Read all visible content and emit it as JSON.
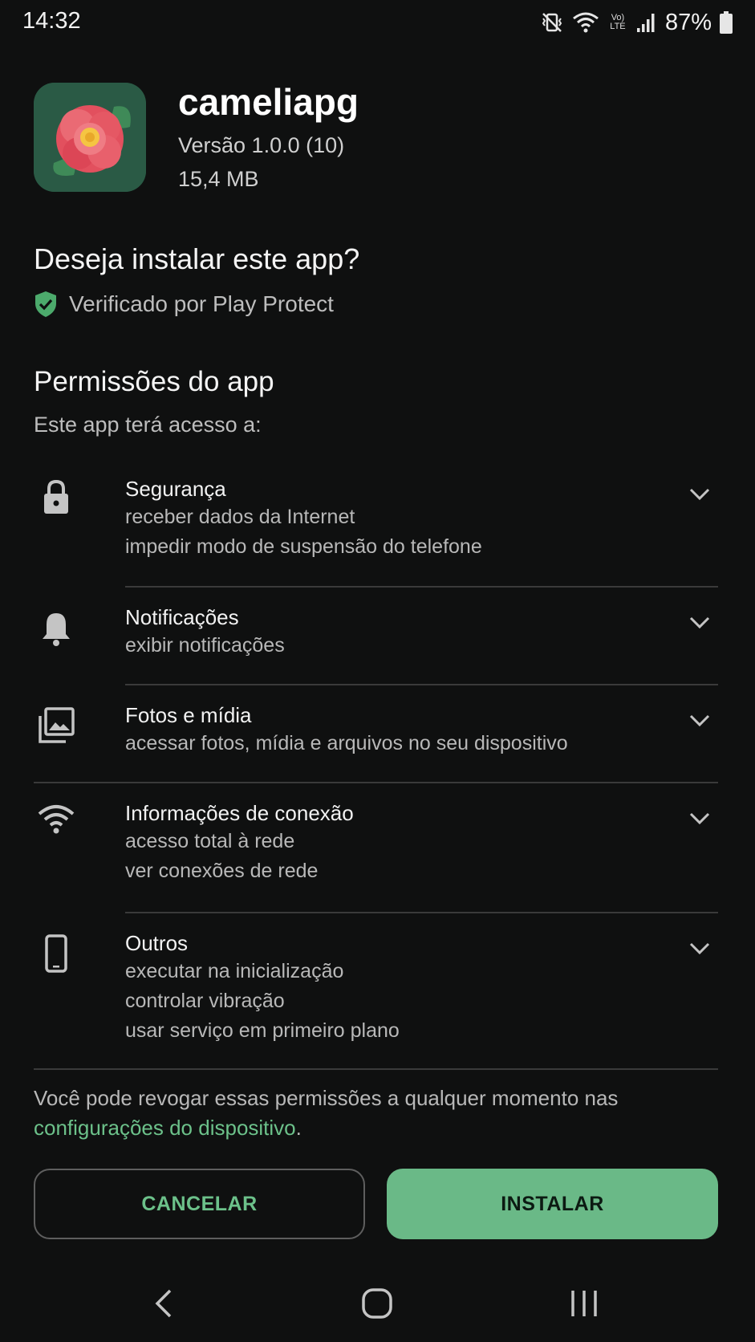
{
  "status_bar": {
    "time": "14:32",
    "volte_top": "Vo)",
    "volte_bottom": "LTE",
    "battery": "87%",
    "icons": [
      "vibrate-icon",
      "wifi-icon",
      "volte-icon",
      "signal-icon",
      "battery-icon"
    ]
  },
  "app": {
    "name": "cameliapg",
    "version": "Versão 1.0.0 (10)",
    "size": "15,4 MB"
  },
  "question": "Deseja instalar este app?",
  "verified": "Verificado por Play Protect",
  "permissions": {
    "title": "Permissões do app",
    "subtitle": "Este app terá acesso a:",
    "groups": [
      {
        "name": "Segurança",
        "icon": "lock-icon",
        "items": [
          "receber dados da Internet",
          "impedir modo de suspensão do telefone"
        ]
      },
      {
        "name": "Notificações",
        "icon": "bell-icon",
        "items": [
          "exibir notificações"
        ]
      },
      {
        "name": "Fotos e mídia",
        "icon": "photos-icon",
        "items": [
          "acessar fotos, mídia e arquivos no seu dispositivo"
        ]
      },
      {
        "name": "Informações de conexão",
        "icon": "wifi-icon",
        "items": [
          "acesso total à rede",
          "ver conexões de rede"
        ]
      },
      {
        "name": "Outros",
        "icon": "phone-icon",
        "items": [
          "executar na inicialização",
          "controlar vibração",
          "usar serviço em primeiro plano"
        ]
      }
    ]
  },
  "revoke": {
    "text": "Você pode revogar essas permissões a qualquer momento nas ",
    "link": "configurações do dispositivo",
    "end": "."
  },
  "buttons": {
    "cancel": "CANCELAR",
    "install": "INSTALAR"
  },
  "nav": [
    "back-icon",
    "home-icon",
    "recents-icon"
  ],
  "colors": {
    "background": "#0f1010",
    "accent": "#6cc18a",
    "install_button": "#6ab987",
    "divider": "#3a3a3a"
  }
}
